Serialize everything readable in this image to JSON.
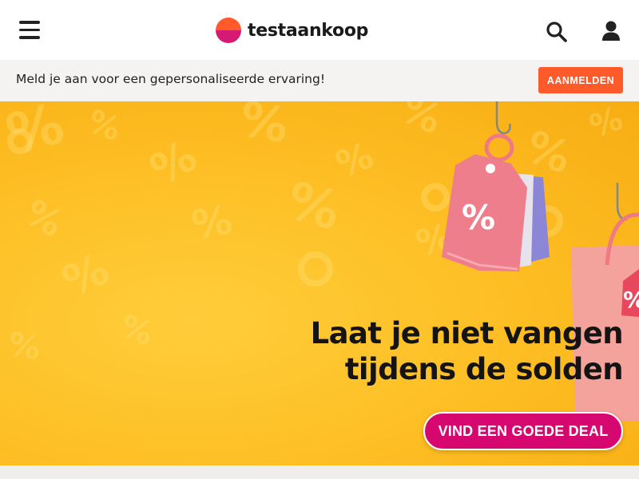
{
  "header": {
    "menu_icon": "hamburger-menu-icon",
    "logo_text": "testaankoop",
    "logo_colors": {
      "top": "#ff5a2a",
      "bottom": "#d61a73"
    },
    "search_icon": "search-icon",
    "account_icon": "user-icon"
  },
  "banner": {
    "text": "Meld je aan voor een gepersonaliseerde ervaring!",
    "button_label": "AANMELDEN",
    "button_color": "#ff5a2a"
  },
  "hero": {
    "title_line1": "Laat je niet vangen",
    "title_line2": "tijdens de solden",
    "cta_label": "VIND EEN GOEDE DEAL",
    "cta_color": "#d6076f",
    "background_color": "#fdbd22",
    "illustration": "price-tags-on-fish-hooks"
  }
}
